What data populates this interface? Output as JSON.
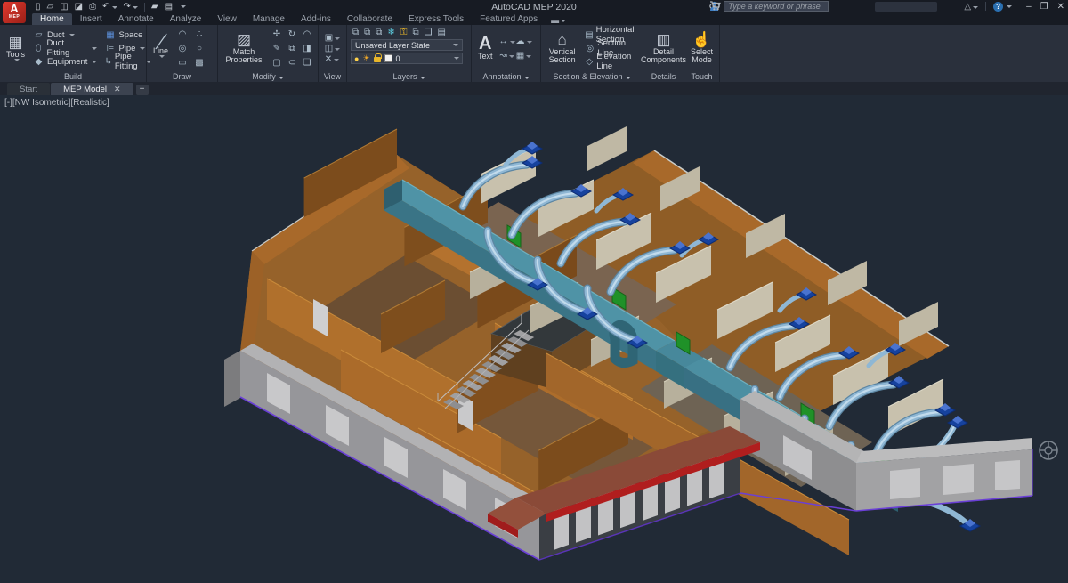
{
  "titlebar": {
    "app_title": "AutoCAD MEP 2020",
    "search_placeholder": "Type a keyword or phrase",
    "logo_letter": "A",
    "logo_sub": "MEP",
    "minimize": "–",
    "restore": "❐",
    "close": "✕",
    "help": "?"
  },
  "ribbon_tabs": [
    {
      "label": "Home"
    },
    {
      "label": "Insert"
    },
    {
      "label": "Annotate"
    },
    {
      "label": "Analyze"
    },
    {
      "label": "View"
    },
    {
      "label": "Manage"
    },
    {
      "label": "Add-ins"
    },
    {
      "label": "Collaborate"
    },
    {
      "label": "Express Tools"
    },
    {
      "label": "Featured Apps"
    }
  ],
  "panels": {
    "build": {
      "label": "Build",
      "tools": "Tools",
      "duct": "Duct",
      "duct_fitting": "Duct Fitting",
      "equipment": "Equipment",
      "space": "Space",
      "pipe": "Pipe",
      "pipe_fitting": "Pipe Fitting"
    },
    "draw": {
      "label": "Draw",
      "line": "Line"
    },
    "modify": {
      "label": "Modify",
      "match": "Match Properties"
    },
    "view": {
      "label": "View"
    },
    "layers": {
      "label": "Layers",
      "state_value": "Unsaved Layer State",
      "current_layer": "0"
    },
    "annotation": {
      "label": "Annotation",
      "big_a": "A",
      "text": "Text"
    },
    "section": {
      "label": "Section & Elevation",
      "vertical": "Vertical Section",
      "horizontal": "Horizontal Section",
      "section_line": "Section Line",
      "elevation_line": "Elevation Line"
    },
    "details": {
      "label": "Details",
      "button": "Detail Components"
    },
    "touch": {
      "label": "Touch",
      "button": "Select Mode"
    }
  },
  "filetabs": {
    "start": "Start",
    "active_doc": "MEP Model",
    "close": "✕",
    "new_tab": "+"
  },
  "viewport": {
    "label": "[-][NW Isometric][Realistic]"
  },
  "colors": {
    "canvas_bg": "#212a36",
    "duct_teal": "#4f93a6",
    "branch_blue": "#8fb7d4",
    "diffuser_blue": "#1e4fb0",
    "fitting_green": "#1f9128",
    "wall_orange": "#a8692a",
    "partition_beige": "#c8c1ad",
    "exterior_gray": "#96969a",
    "canopy_red": "#b01e1e",
    "ground_purple": "#6a3fd6"
  }
}
